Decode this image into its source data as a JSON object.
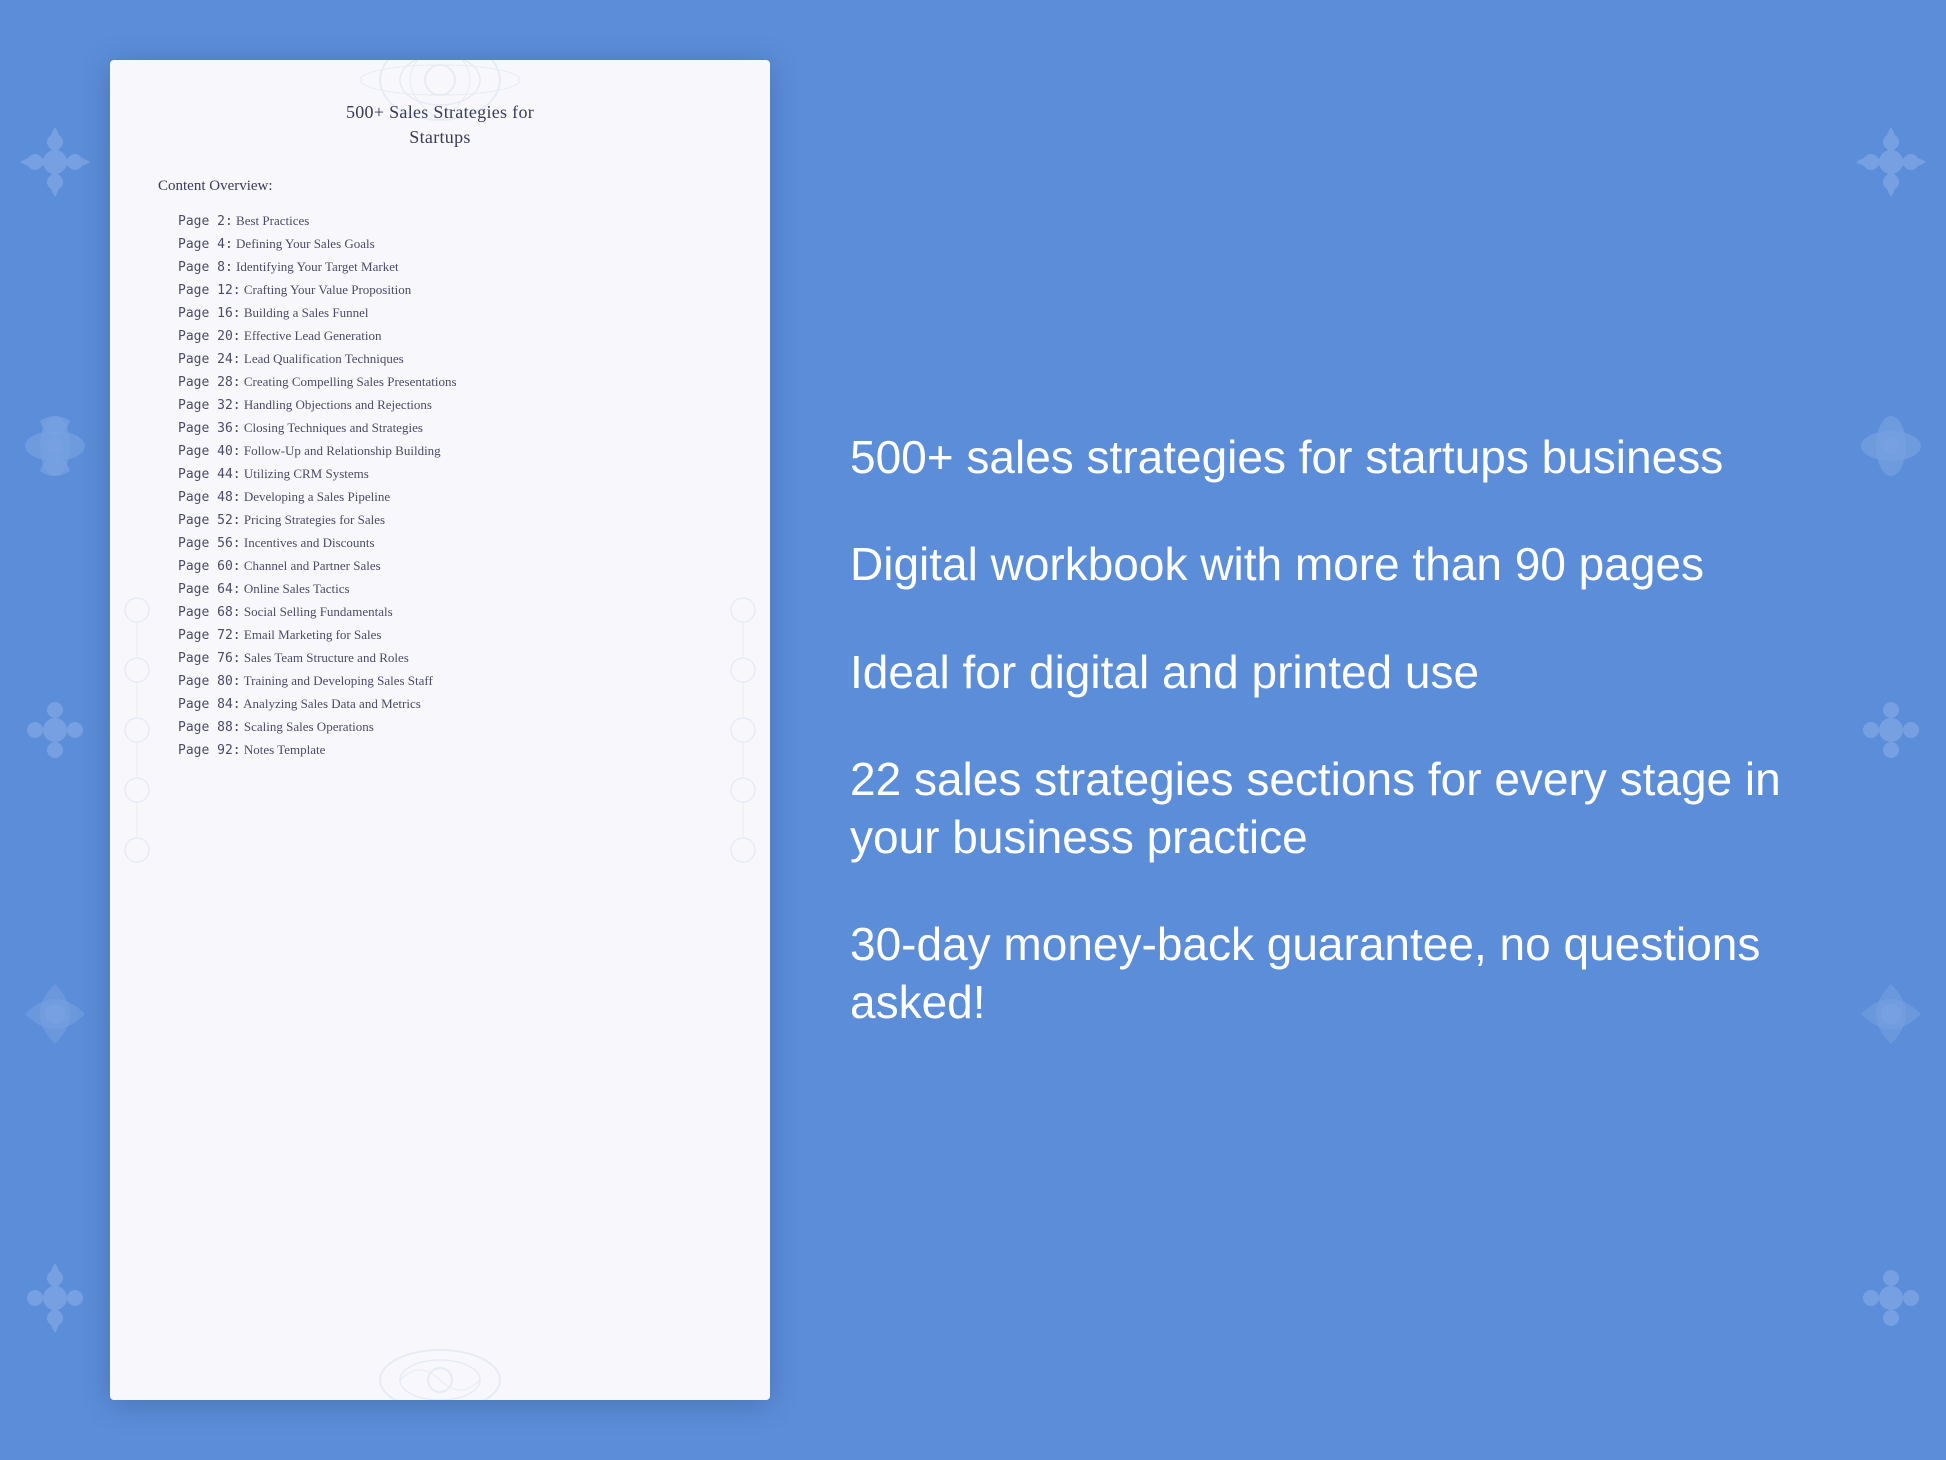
{
  "background_color": "#5b8dd9",
  "document": {
    "title_line1": "500+ Sales Strategies for",
    "title_line2": "Startups",
    "toc_header": "Content Overview:",
    "toc_items": [
      {
        "page": "Page  2:",
        "title": "Best Practices"
      },
      {
        "page": "Page  4:",
        "title": "Defining Your Sales Goals"
      },
      {
        "page": "Page  8:",
        "title": "Identifying Your Target Market"
      },
      {
        "page": "Page 12:",
        "title": "Crafting Your Value Proposition"
      },
      {
        "page": "Page 16:",
        "title": "Building a Sales Funnel"
      },
      {
        "page": "Page 20:",
        "title": "Effective Lead Generation"
      },
      {
        "page": "Page 24:",
        "title": "Lead Qualification Techniques"
      },
      {
        "page": "Page 28:",
        "title": "Creating Compelling Sales Presentations"
      },
      {
        "page": "Page 32:",
        "title": "Handling Objections and Rejections"
      },
      {
        "page": "Page 36:",
        "title": "Closing Techniques and Strategies"
      },
      {
        "page": "Page 40:",
        "title": "Follow-Up and Relationship Building"
      },
      {
        "page": "Page 44:",
        "title": "Utilizing CRM Systems"
      },
      {
        "page": "Page 48:",
        "title": "Developing a Sales Pipeline"
      },
      {
        "page": "Page 52:",
        "title": "Pricing Strategies for Sales"
      },
      {
        "page": "Page 56:",
        "title": "Incentives and Discounts"
      },
      {
        "page": "Page 60:",
        "title": "Channel and Partner Sales"
      },
      {
        "page": "Page 64:",
        "title": "Online Sales Tactics"
      },
      {
        "page": "Page 68:",
        "title": "Social Selling Fundamentals"
      },
      {
        "page": "Page 72:",
        "title": "Email Marketing for Sales"
      },
      {
        "page": "Page 76:",
        "title": "Sales Team Structure and Roles"
      },
      {
        "page": "Page 80:",
        "title": "Training and Developing Sales Staff"
      },
      {
        "page": "Page 84:",
        "title": "Analyzing Sales Data and Metrics"
      },
      {
        "page": "Page 88:",
        "title": "Scaling Sales Operations"
      },
      {
        "page": "Page 92:",
        "title": "Notes Template"
      }
    ]
  },
  "info_bullets": [
    "500+ sales strategies\nfor startups business",
    "Digital workbook with\nmore than 90 pages",
    "Ideal for digital and\nprinted use",
    "22 sales strategies\nsections for every stage\nin your business\npractice",
    "30-day money-back\nguarantee, no\nquestions asked!"
  ]
}
